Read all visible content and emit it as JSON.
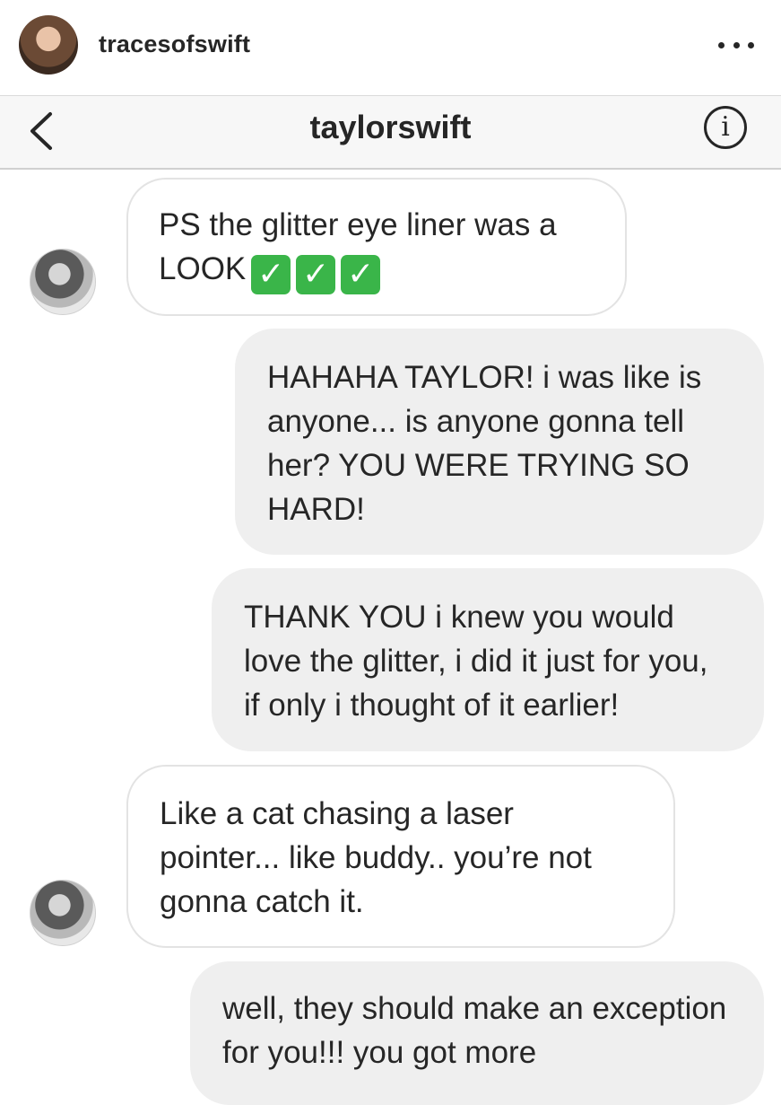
{
  "post": {
    "username": "tracesofswift"
  },
  "dm": {
    "title": "taylorswift",
    "info_glyph": "i"
  },
  "messages": [
    {
      "side": "in",
      "text": "PS the glitter eye liner was a LOOK",
      "emoji": [
        "✓",
        "✓",
        "✓"
      ]
    },
    {
      "side": "out",
      "text": "HAHAHA TAYLOR! i was like is anyone... is anyone gonna tell her? YOU WERE TRYING SO HARD!"
    },
    {
      "side": "out",
      "text": "THANK YOU i knew you would love the glitter, i did it just for you, if only i thought of it earlier!"
    },
    {
      "side": "in",
      "text": "Like a cat chasing a laser pointer... like buddy.. you’re not gonna catch it."
    },
    {
      "side": "out",
      "text": "well, they should make an exception for you!!! you got more"
    }
  ],
  "colors": {
    "incoming_bubble": "#ffffff",
    "outgoing_bubble": "#efefef",
    "emoji_check": "#3ab549"
  }
}
